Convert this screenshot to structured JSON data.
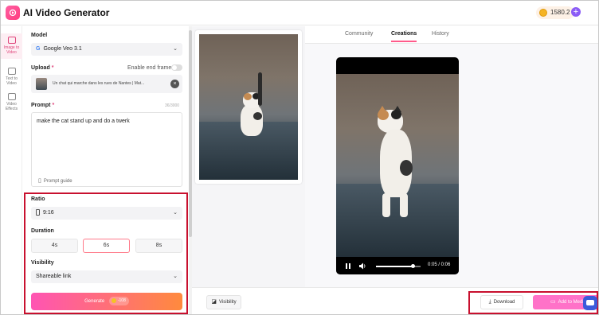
{
  "app": {
    "title": "AI Video Generator"
  },
  "header": {
    "credits": "1580.2",
    "add_label": "+"
  },
  "nav": {
    "items": [
      {
        "label": "Image to Video",
        "icon": "image-to-video-icon"
      },
      {
        "label": "Text to Video",
        "icon": "text-to-video-icon"
      },
      {
        "label": "Video Effects",
        "icon": "video-effects-icon"
      }
    ]
  },
  "form": {
    "model_label": "Model",
    "model_value": "Google Veo 3.1",
    "upload_label": "Upload",
    "required_mark": "*",
    "end_frame_label": "Enable end frame",
    "upload_filename": "Un chat qui marche dans les rues de Nantes | Mat...",
    "prompt_label": "Prompt",
    "prompt_counter": "36/3000",
    "prompt_text": "make the cat stand up and do a twerk",
    "prompt_guide": "Prompt guide",
    "ratio_label": "Ratio",
    "ratio_value": "9:16",
    "duration_label": "Duration",
    "durations": [
      "4s",
      "6s",
      "8s"
    ],
    "duration_selected": "6s",
    "visibility_label": "Visibility",
    "visibility_value": "Shareable link",
    "generate_label": "Generate",
    "generate_cost": "-108"
  },
  "tabs": [
    "Community",
    "Creations",
    "History"
  ],
  "active_tab": "Creations",
  "player": {
    "time": "0:05 / 0:06",
    "progress": 0.83
  },
  "bottombar": {
    "visibility_label": "Visibility",
    "download_label": "Download",
    "add_media_label": "Add to Media"
  },
  "colors": {
    "accent": "#ff5a8a",
    "highlight_box": "#c8102e",
    "generate_start": "#ff54b3",
    "generate_end": "#ff8a3d"
  }
}
